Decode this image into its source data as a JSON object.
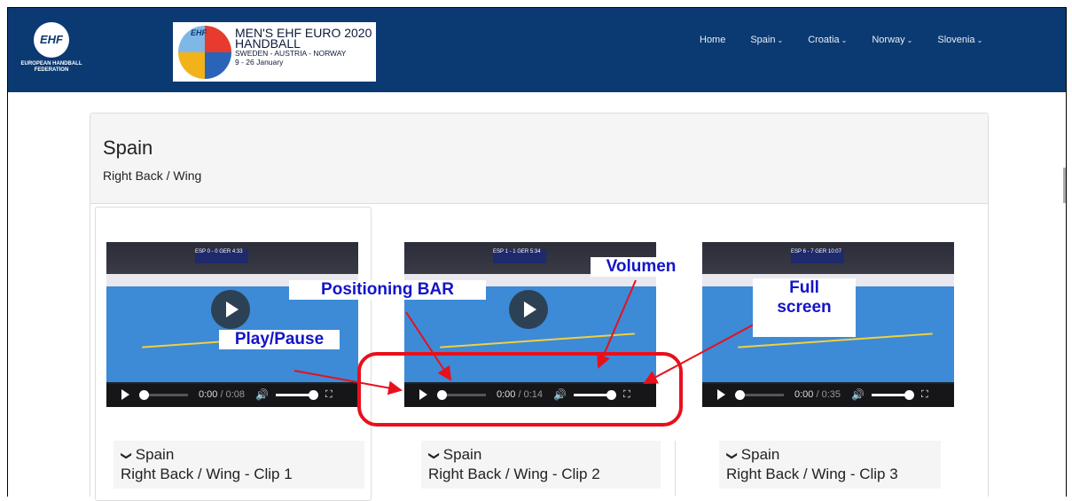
{
  "navbar": {
    "logo_text": "EHF",
    "logo_sub": "EUROPEAN HANDBALL FEDERATION",
    "banner": {
      "ball_text": "EHF",
      "line1": "MEN'S EHF EURO 2020",
      "line2": "HANDBALL",
      "line3": "SWEDEN - AUSTRIA - NORWAY",
      "line4": "9 - 26 January"
    },
    "links": [
      {
        "label": "Home",
        "dropdown": false
      },
      {
        "label": "Spain",
        "dropdown": true
      },
      {
        "label": "Croatia",
        "dropdown": true
      },
      {
        "label": "Norway",
        "dropdown": true
      },
      {
        "label": "Slovenia",
        "dropdown": true
      }
    ],
    "caret_glyph": "⌄"
  },
  "panel": {
    "title": "Spain",
    "subtitle": "Right Back / Wing"
  },
  "videos": [
    {
      "current": "0:00",
      "duration": "0:08",
      "progress": 0.0,
      "volume": 1.0,
      "overlay_score": "ESP 0 - 0 GER 4:33"
    },
    {
      "current": "0:00",
      "duration": "0:14",
      "progress": 0.0,
      "volume": 1.0,
      "overlay_score": "ESP 1 - 1 GER 5:34"
    },
    {
      "current": "0:00",
      "duration": "0:35",
      "progress": 0.0,
      "volume": 1.0,
      "overlay_score": "ESP 6 - 7 GER 10:07"
    }
  ],
  "time_separator": " / ",
  "clips": [
    {
      "country": "Spain",
      "title": "Right Back / Wing - Clip 1"
    },
    {
      "country": "Spain",
      "title": "Right Back / Wing - Clip 2"
    },
    {
      "country": "Spain",
      "title": "Right Back / Wing - Clip 3"
    }
  ],
  "clip_chevron": "❯",
  "annotations": {
    "positioning_bar": "Positioning BAR",
    "play_pause": "Play/Pause",
    "volumen": "Volumen",
    "full_screen_1": "Full",
    "full_screen_2": "screen"
  },
  "colors": {
    "navbar_bg": "#0b3a72",
    "annotation_text": "#1414c8",
    "highlight_ring": "#e8101c",
    "court_blue": "#3d8ad6"
  },
  "icons": {
    "play": "play-icon",
    "volume": "volume-icon",
    "fullscreen": "fullscreen-icon",
    "chevron": "chevron-down-icon"
  }
}
